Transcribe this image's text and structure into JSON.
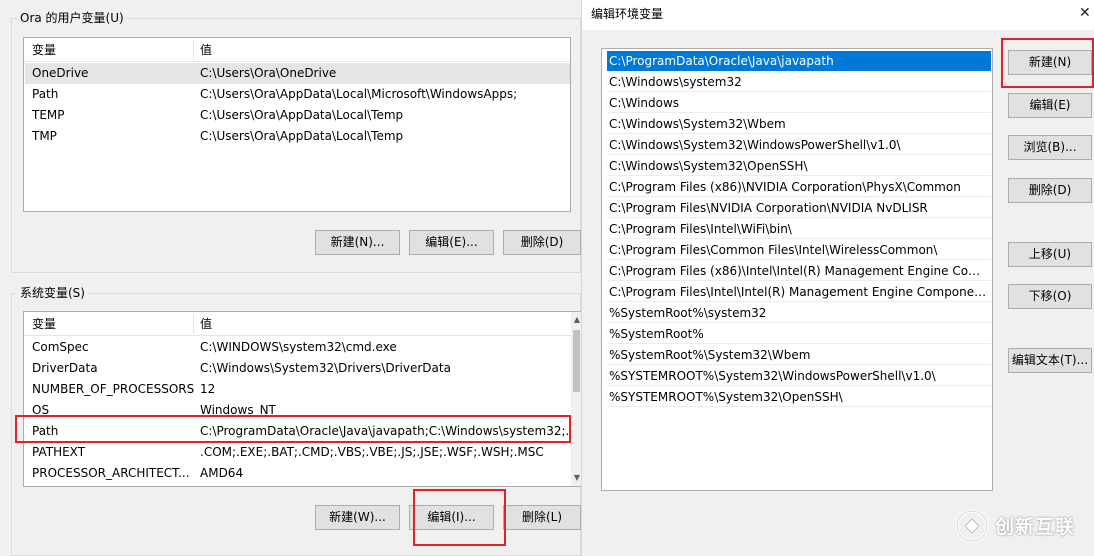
{
  "user_vars": {
    "group_title": "Ora 的用户变量(U)",
    "col_name": "变量",
    "col_value": "值",
    "rows": [
      {
        "name": "OneDrive",
        "value": "C:\\Users\\Ora\\OneDrive"
      },
      {
        "name": "Path",
        "value": "C:\\Users\\Ora\\AppData\\Local\\Microsoft\\WindowsApps;"
      },
      {
        "name": "TEMP",
        "value": "C:\\Users\\Ora\\AppData\\Local\\Temp"
      },
      {
        "name": "TMP",
        "value": "C:\\Users\\Ora\\AppData\\Local\\Temp"
      }
    ],
    "buttons": {
      "new": "新建(N)...",
      "edit": "编辑(E)...",
      "delete": "删除(D)"
    }
  },
  "system_vars": {
    "group_title": "系统变量(S)",
    "col_name": "变量",
    "col_value": "值",
    "rows": [
      {
        "name": "ComSpec",
        "value": "C:\\WINDOWS\\system32\\cmd.exe"
      },
      {
        "name": "DriverData",
        "value": "C:\\Windows\\System32\\Drivers\\DriverData"
      },
      {
        "name": "NUMBER_OF_PROCESSORS",
        "value": "12"
      },
      {
        "name": "OS",
        "value": "Windows_NT"
      },
      {
        "name": "Path",
        "value": "C:\\ProgramData\\Oracle\\Java\\javapath;C:\\Windows\\system32;..."
      },
      {
        "name": "PATHEXT",
        "value": ".COM;.EXE;.BAT;.CMD;.VBS;.VBE;.JS;.JSE;.WSF;.WSH;.MSC"
      },
      {
        "name": "PROCESSOR_ARCHITECT...",
        "value": "AMD64"
      }
    ],
    "buttons": {
      "new": "新建(W)...",
      "edit": "编辑(I)...",
      "delete": "删除(L)"
    }
  },
  "dialog": {
    "title": "编辑环境变量",
    "close_glyph": "✕",
    "paths": [
      "C:\\ProgramData\\Oracle\\Java\\javapath",
      "C:\\Windows\\system32",
      "C:\\Windows",
      "C:\\Windows\\System32\\Wbem",
      "C:\\Windows\\System32\\WindowsPowerShell\\v1.0\\",
      "C:\\Windows\\System32\\OpenSSH\\",
      "C:\\Program Files (x86)\\NVIDIA Corporation\\PhysX\\Common",
      "C:\\Program Files\\NVIDIA Corporation\\NVIDIA NvDLISR",
      "C:\\Program Files\\Intel\\WiFi\\bin\\",
      "C:\\Program Files\\Common Files\\Intel\\WirelessCommon\\",
      "C:\\Program Files (x86)\\Intel\\Intel(R) Management Engine Comp...",
      "C:\\Program Files\\Intel\\Intel(R) Management Engine Component...",
      "%SystemRoot%\\system32",
      "%SystemRoot%",
      "%SystemRoot%\\System32\\Wbem",
      "%SYSTEMROOT%\\System32\\WindowsPowerShell\\v1.0\\",
      "%SYSTEMROOT%\\System32\\OpenSSH\\"
    ],
    "buttons": {
      "new": "新建(N)",
      "edit": "编辑(E)",
      "browse": "浏览(B)...",
      "delete": "删除(D)",
      "move_up": "上移(U)",
      "move_down": "下移(O)",
      "edit_text": "编辑文本(T)..."
    }
  },
  "watermark": {
    "text": "创新互联"
  },
  "colors": {
    "selection": "#0078d7",
    "highlight_box": "#e2222b",
    "window_bg": "#f0f0f0"
  }
}
